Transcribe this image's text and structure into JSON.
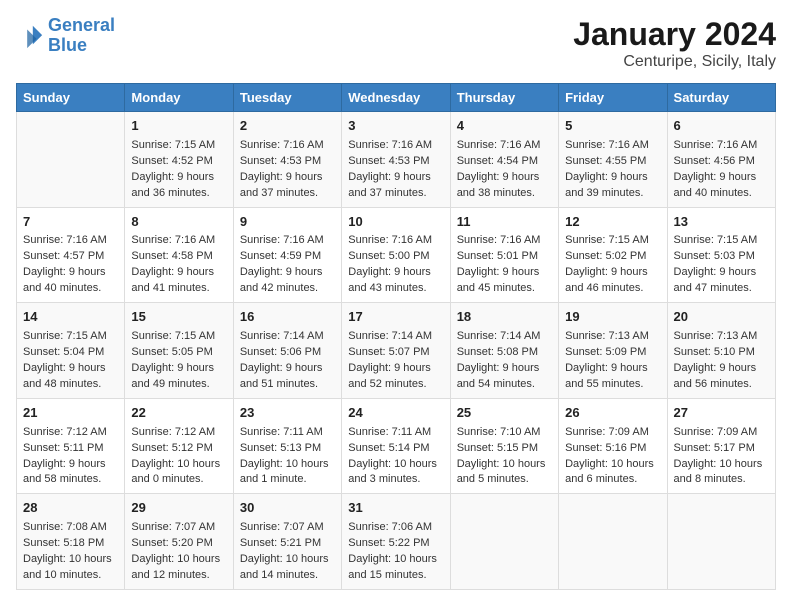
{
  "header": {
    "logo_general": "General",
    "logo_blue": "Blue",
    "title": "January 2024",
    "subtitle": "Centuripe, Sicily, Italy"
  },
  "weekdays": [
    "Sunday",
    "Monday",
    "Tuesday",
    "Wednesday",
    "Thursday",
    "Friday",
    "Saturday"
  ],
  "weeks": [
    [
      {
        "day": "",
        "lines": []
      },
      {
        "day": "1",
        "lines": [
          "Sunrise: 7:15 AM",
          "Sunset: 4:52 PM",
          "Daylight: 9 hours",
          "and 36 minutes."
        ]
      },
      {
        "day": "2",
        "lines": [
          "Sunrise: 7:16 AM",
          "Sunset: 4:53 PM",
          "Daylight: 9 hours",
          "and 37 minutes."
        ]
      },
      {
        "day": "3",
        "lines": [
          "Sunrise: 7:16 AM",
          "Sunset: 4:53 PM",
          "Daylight: 9 hours",
          "and 37 minutes."
        ]
      },
      {
        "day": "4",
        "lines": [
          "Sunrise: 7:16 AM",
          "Sunset: 4:54 PM",
          "Daylight: 9 hours",
          "and 38 minutes."
        ]
      },
      {
        "day": "5",
        "lines": [
          "Sunrise: 7:16 AM",
          "Sunset: 4:55 PM",
          "Daylight: 9 hours",
          "and 39 minutes."
        ]
      },
      {
        "day": "6",
        "lines": [
          "Sunrise: 7:16 AM",
          "Sunset: 4:56 PM",
          "Daylight: 9 hours",
          "and 40 minutes."
        ]
      }
    ],
    [
      {
        "day": "7",
        "lines": [
          "Sunrise: 7:16 AM",
          "Sunset: 4:57 PM",
          "Daylight: 9 hours",
          "and 40 minutes."
        ]
      },
      {
        "day": "8",
        "lines": [
          "Sunrise: 7:16 AM",
          "Sunset: 4:58 PM",
          "Daylight: 9 hours",
          "and 41 minutes."
        ]
      },
      {
        "day": "9",
        "lines": [
          "Sunrise: 7:16 AM",
          "Sunset: 4:59 PM",
          "Daylight: 9 hours",
          "and 42 minutes."
        ]
      },
      {
        "day": "10",
        "lines": [
          "Sunrise: 7:16 AM",
          "Sunset: 5:00 PM",
          "Daylight: 9 hours",
          "and 43 minutes."
        ]
      },
      {
        "day": "11",
        "lines": [
          "Sunrise: 7:16 AM",
          "Sunset: 5:01 PM",
          "Daylight: 9 hours",
          "and 45 minutes."
        ]
      },
      {
        "day": "12",
        "lines": [
          "Sunrise: 7:15 AM",
          "Sunset: 5:02 PM",
          "Daylight: 9 hours",
          "and 46 minutes."
        ]
      },
      {
        "day": "13",
        "lines": [
          "Sunrise: 7:15 AM",
          "Sunset: 5:03 PM",
          "Daylight: 9 hours",
          "and 47 minutes."
        ]
      }
    ],
    [
      {
        "day": "14",
        "lines": [
          "Sunrise: 7:15 AM",
          "Sunset: 5:04 PM",
          "Daylight: 9 hours",
          "and 48 minutes."
        ]
      },
      {
        "day": "15",
        "lines": [
          "Sunrise: 7:15 AM",
          "Sunset: 5:05 PM",
          "Daylight: 9 hours",
          "and 49 minutes."
        ]
      },
      {
        "day": "16",
        "lines": [
          "Sunrise: 7:14 AM",
          "Sunset: 5:06 PM",
          "Daylight: 9 hours",
          "and 51 minutes."
        ]
      },
      {
        "day": "17",
        "lines": [
          "Sunrise: 7:14 AM",
          "Sunset: 5:07 PM",
          "Daylight: 9 hours",
          "and 52 minutes."
        ]
      },
      {
        "day": "18",
        "lines": [
          "Sunrise: 7:14 AM",
          "Sunset: 5:08 PM",
          "Daylight: 9 hours",
          "and 54 minutes."
        ]
      },
      {
        "day": "19",
        "lines": [
          "Sunrise: 7:13 AM",
          "Sunset: 5:09 PM",
          "Daylight: 9 hours",
          "and 55 minutes."
        ]
      },
      {
        "day": "20",
        "lines": [
          "Sunrise: 7:13 AM",
          "Sunset: 5:10 PM",
          "Daylight: 9 hours",
          "and 56 minutes."
        ]
      }
    ],
    [
      {
        "day": "21",
        "lines": [
          "Sunrise: 7:12 AM",
          "Sunset: 5:11 PM",
          "Daylight: 9 hours",
          "and 58 minutes."
        ]
      },
      {
        "day": "22",
        "lines": [
          "Sunrise: 7:12 AM",
          "Sunset: 5:12 PM",
          "Daylight: 10 hours",
          "and 0 minutes."
        ]
      },
      {
        "day": "23",
        "lines": [
          "Sunrise: 7:11 AM",
          "Sunset: 5:13 PM",
          "Daylight: 10 hours",
          "and 1 minute."
        ]
      },
      {
        "day": "24",
        "lines": [
          "Sunrise: 7:11 AM",
          "Sunset: 5:14 PM",
          "Daylight: 10 hours",
          "and 3 minutes."
        ]
      },
      {
        "day": "25",
        "lines": [
          "Sunrise: 7:10 AM",
          "Sunset: 5:15 PM",
          "Daylight: 10 hours",
          "and 5 minutes."
        ]
      },
      {
        "day": "26",
        "lines": [
          "Sunrise: 7:09 AM",
          "Sunset: 5:16 PM",
          "Daylight: 10 hours",
          "and 6 minutes."
        ]
      },
      {
        "day": "27",
        "lines": [
          "Sunrise: 7:09 AM",
          "Sunset: 5:17 PM",
          "Daylight: 10 hours",
          "and 8 minutes."
        ]
      }
    ],
    [
      {
        "day": "28",
        "lines": [
          "Sunrise: 7:08 AM",
          "Sunset: 5:18 PM",
          "Daylight: 10 hours",
          "and 10 minutes."
        ]
      },
      {
        "day": "29",
        "lines": [
          "Sunrise: 7:07 AM",
          "Sunset: 5:20 PM",
          "Daylight: 10 hours",
          "and 12 minutes."
        ]
      },
      {
        "day": "30",
        "lines": [
          "Sunrise: 7:07 AM",
          "Sunset: 5:21 PM",
          "Daylight: 10 hours",
          "and 14 minutes."
        ]
      },
      {
        "day": "31",
        "lines": [
          "Sunrise: 7:06 AM",
          "Sunset: 5:22 PM",
          "Daylight: 10 hours",
          "and 15 minutes."
        ]
      },
      {
        "day": "",
        "lines": []
      },
      {
        "day": "",
        "lines": []
      },
      {
        "day": "",
        "lines": []
      }
    ]
  ]
}
